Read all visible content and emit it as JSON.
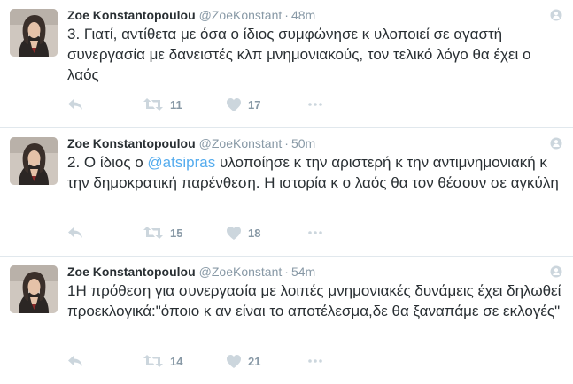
{
  "tweets": [
    {
      "name": "Zoe Konstantopoulou",
      "handle": "@ZoeKonstant",
      "separator": "·",
      "time": "48m",
      "text_before": "3. Γιατί, αντίθετα με όσα ο ίδιος συμφώνησε κ υλοποιεί σε αγαστή συνεργασία με δανειστές κλπ μνημονιακούς,  τον τελικό λόγο θα έχει ο λαός",
      "mention": "",
      "text_after": "",
      "retweets": "11",
      "likes": "17"
    },
    {
      "name": "Zoe Konstantopoulou",
      "handle": "@ZoeKonstant",
      "separator": "·",
      "time": "50m",
      "text_before": "2. Ο ίδιος ο ",
      "mention": "@atsipras",
      "text_after": " υλοποίησε κ την αριστερή κ την αντιμνημονιακή κ την δημοκρατική παρένθεση. Η ιστορία κ ο λαός θα τον θέσουν σε αγκύλη",
      "retweets": "15",
      "likes": "18"
    },
    {
      "name": "Zoe Konstantopoulou",
      "handle": "@ZoeKonstant",
      "separator": "·",
      "time": "54m",
      "text_before": "1Η πρόθεση για συνεργασία με λοιπές μνημονιακές δυνάμεις έχει δηλωθεί προεκλογικά:\"όποιο κ αν είναι το αποτέλεσμα,δε θα ξαναπάμε σε εκλογές\"",
      "mention": "",
      "text_after": "",
      "retweets": "14",
      "likes": "21"
    }
  ],
  "colors": {
    "text": "#292f33",
    "secondary": "#8899a6",
    "link": "#55acee",
    "divider": "#e1e8ed"
  },
  "icons": [
    "reply-icon",
    "retweet-icon",
    "like-icon",
    "more-icon",
    "follow-icon"
  ]
}
